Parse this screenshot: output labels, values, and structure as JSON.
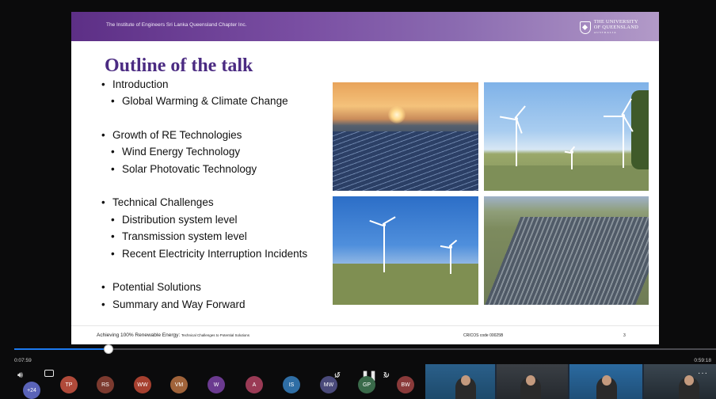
{
  "slide": {
    "org_name": "The Institute of Engineers Sri Lanka Queensland Chapter Inc.",
    "logo": {
      "line1": "THE UNIVERSITY",
      "line2": "OF QUEENSLAND",
      "line3": "AUSTRALIA"
    },
    "title": "Outline of the talk",
    "outline": [
      {
        "text": "Introduction",
        "level": 1
      },
      {
        "text": "Global Warming & Climate Change",
        "level": 2
      },
      {
        "text": "Growth of RE Technologies",
        "level": 1
      },
      {
        "text": "Wind Energy Technology",
        "level": 2
      },
      {
        "text": "Solar Photovatic Technology",
        "level": 2
      },
      {
        "text": "Technical Challenges",
        "level": 1
      },
      {
        "text": "Distribution system level",
        "level": 2
      },
      {
        "text": "Transmission system level",
        "level": 2
      },
      {
        "text": "Recent Electricity Interruption Incidents",
        "level": 2
      },
      {
        "text": "Potential Solutions",
        "level": 1
      },
      {
        "text": "Summary and Way Forward",
        "level": 1
      }
    ],
    "footer": {
      "title_main": "Achieving 100% Renewable Energy:",
      "title_sub": "Technical Challenges to Potential Solutions",
      "cricos": "CRICOS code 00025B",
      "page": "3"
    }
  },
  "player": {
    "current_time": "0:07:59",
    "duration": "0:59:18",
    "progress_fraction": 0.1347,
    "participants_badge": "+24",
    "skip_back_label": "10",
    "skip_forward_label": "30",
    "participants": [
      "TP",
      "RS",
      "WW",
      "VM",
      "W",
      "A",
      "IS",
      "MW",
      "GP",
      "BW"
    ],
    "more_label": "···"
  },
  "colors": {
    "header_purple": "#5d2f86",
    "title_purple": "#4b2b82",
    "progress_blue": "#1d7af0"
  }
}
